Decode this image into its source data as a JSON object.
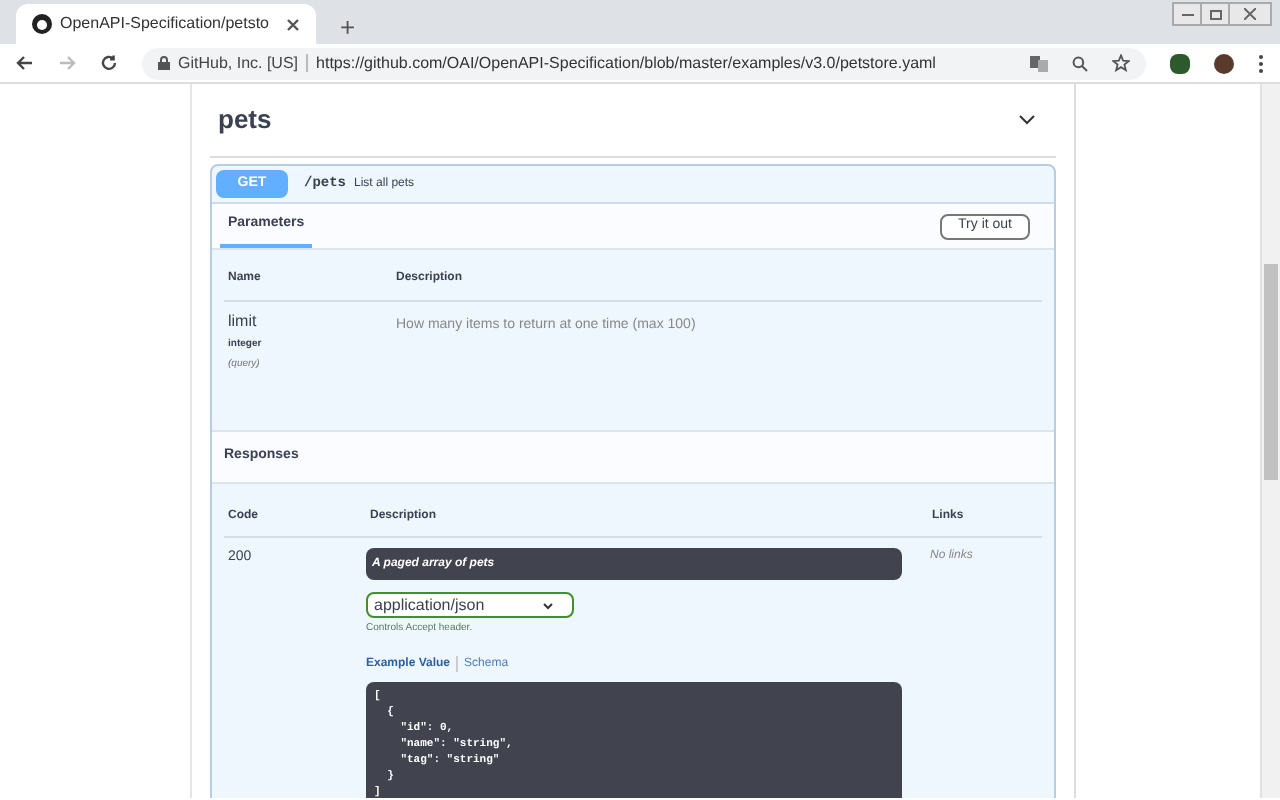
{
  "browser": {
    "tab_title": "OpenAPI-Specification/petsto",
    "new_tab": "+",
    "site_identity": "GitHub, Inc. [US]",
    "url": "https://github.com/OAI/OpenAPI-Specification/blob/master/examples/v3.0/petstore.yaml"
  },
  "section": {
    "title": "pets",
    "expanded": true
  },
  "operation": {
    "method": "GET",
    "path": "/pets",
    "summary": "List all pets",
    "tabs": [
      {
        "label": "Parameters",
        "selected": true
      }
    ],
    "try_button": "Try it out",
    "param_columns": [
      "Name",
      "Description"
    ],
    "params": [
      {
        "name": "limit",
        "type": "integer",
        "location": "(query)",
        "description": "How many items to return at one time (max 100)"
      }
    ],
    "responses_title": "Responses",
    "response_columns": [
      "Code",
      "Description",
      "Links"
    ],
    "responses": [
      {
        "code": "200",
        "description": "A paged array of pets",
        "media_type": "application/json",
        "media_hint": "Controls Accept header.",
        "example_tabs": [
          {
            "label": "Example Value",
            "selected": true
          },
          {
            "label": "Schema",
            "selected": false
          }
        ],
        "example_lines": [
          "[",
          "  {",
          "    \"id\": 0,",
          "    \"name\": \"string\",",
          "    \"tag\": \"string\"",
          "  }",
          "]"
        ],
        "links": "No links"
      }
    ]
  }
}
